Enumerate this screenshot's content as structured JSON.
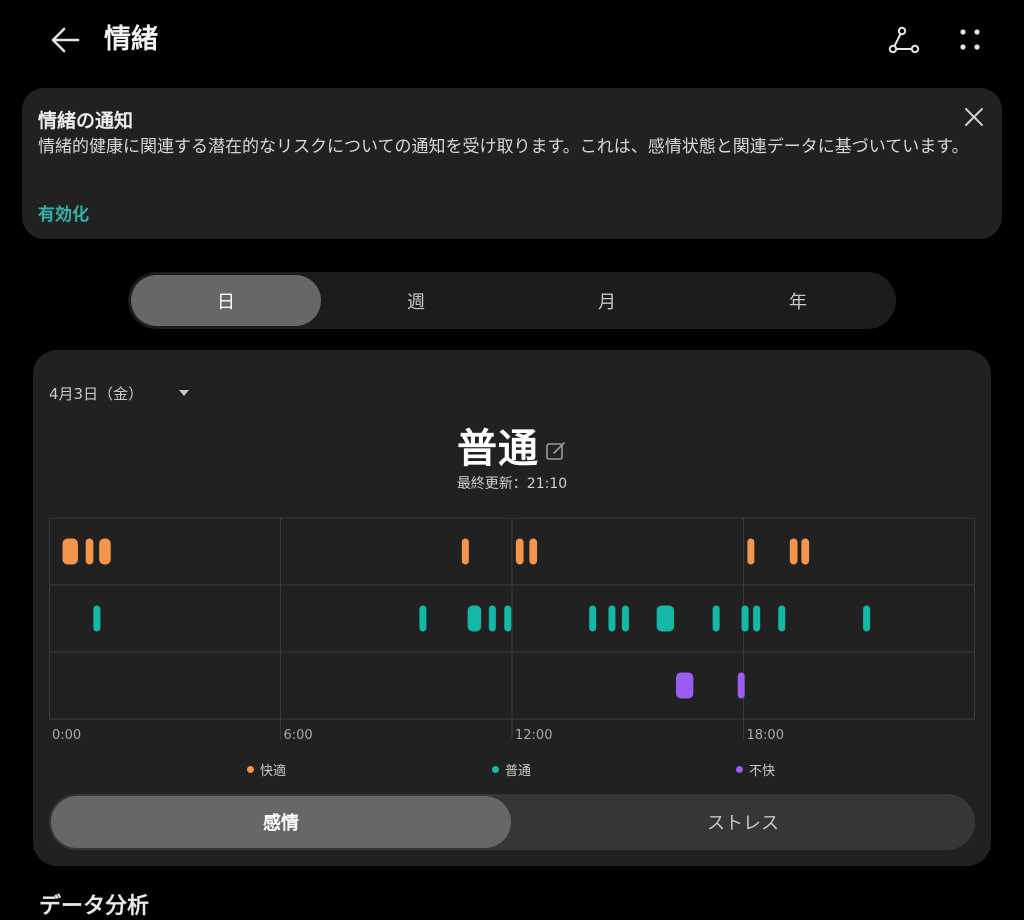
{
  "header": {
    "title": "情緒",
    "back_icon": "arrow-left-icon",
    "share_icon": "share-nodes-icon",
    "more_icon": "more-dots-icon"
  },
  "notice": {
    "title": "情緒の通知",
    "body": "情緒的健康に関連する潜在的なリスクについての通知を受け取ります。これは、感情状態と関連データに基づいています。",
    "action": "有効化",
    "close_icon": "close-icon",
    "accent": "#33b3ad"
  },
  "period_tabs": [
    {
      "label": "日",
      "active": true
    },
    {
      "label": "週",
      "active": false
    },
    {
      "label": "月",
      "active": false
    },
    {
      "label": "年",
      "active": false
    }
  ],
  "summary": {
    "date": "4月3日（金）",
    "mood": "普通",
    "updated": "最終更新：21:10"
  },
  "chart_data": {
    "type": "timeline",
    "x_ticks": [
      "0:00",
      "6:00",
      "12:00",
      "18:00"
    ],
    "x_range_hours": [
      0,
      24
    ],
    "grid": true,
    "rows": [
      {
        "name": "快適",
        "color": "#f5944d",
        "events": [
          [
            0.35,
            0.75
          ],
          [
            0.95,
            1.15
          ],
          [
            1.3,
            1.6
          ],
          [
            10.7,
            10.85
          ],
          [
            12.1,
            12.3
          ],
          [
            12.45,
            12.65
          ],
          [
            18.1,
            18.25
          ],
          [
            19.2,
            19.4
          ],
          [
            19.5,
            19.7
          ]
        ]
      },
      {
        "name": "普通",
        "color": "#14b8a6",
        "events": [
          [
            1.15,
            1.3
          ],
          [
            9.6,
            9.75
          ],
          [
            10.85,
            11.2
          ],
          [
            11.4,
            11.55
          ],
          [
            11.8,
            11.95
          ],
          [
            14.0,
            14.15
          ],
          [
            14.5,
            14.65
          ],
          [
            14.85,
            15.0
          ],
          [
            15.75,
            16.2
          ],
          [
            17.2,
            17.35
          ],
          [
            17.95,
            18.1
          ],
          [
            18.25,
            18.4
          ],
          [
            18.9,
            19.05
          ],
          [
            21.1,
            21.25
          ]
        ]
      },
      {
        "name": "不快",
        "color": "#9b5cf0",
        "events": [
          [
            16.25,
            16.7
          ],
          [
            17.85,
            18.0
          ]
        ]
      }
    ]
  },
  "metric_tabs": [
    {
      "label": "感情",
      "active": true
    },
    {
      "label": "ストレス",
      "active": false
    }
  ],
  "sections": {
    "analysis_title": "データ分析"
  }
}
